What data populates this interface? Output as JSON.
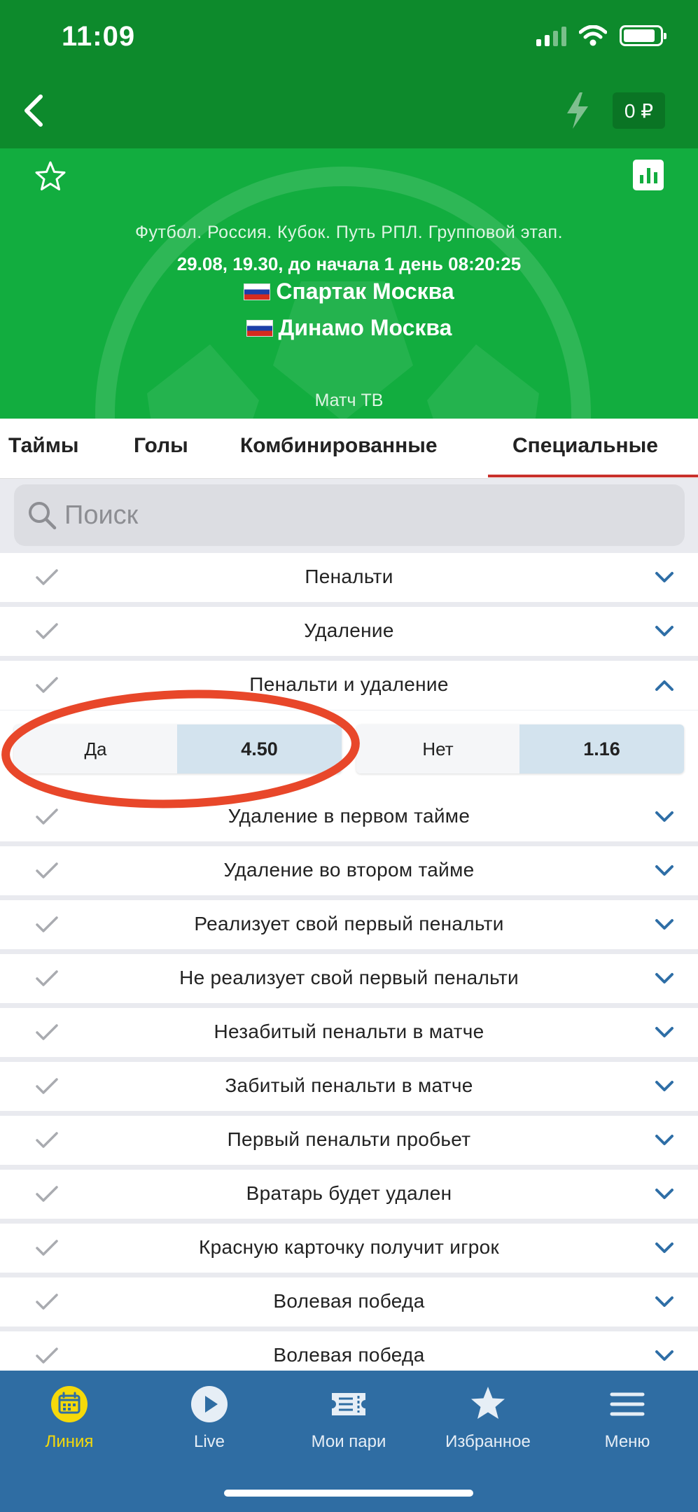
{
  "status": {
    "time": "11:09"
  },
  "topnav": {
    "balance": "0 ₽"
  },
  "match": {
    "league": "Футбол. Россия. Кубок. Путь РПЛ. Групповой этап.",
    "datetime": "29.08, 19.30,  до начала 1 день 08:20:25",
    "team1": "Спартак Москва",
    "team2": "Динамо Москва",
    "broadcast": "Матч ТВ"
  },
  "tabs": [
    {
      "label": "Таймы"
    },
    {
      "label": "Голы"
    },
    {
      "label": "Комбинированные"
    },
    {
      "label": "Специальные",
      "active": true
    }
  ],
  "search": {
    "placeholder": "Поиск"
  },
  "markets": [
    {
      "label": "Пенальти",
      "expanded": false
    },
    {
      "label": "Удаление",
      "expanded": false
    },
    {
      "label": "Пенальти и удаление",
      "expanded": true
    },
    {
      "label": "Удаление в первом тайме",
      "expanded": false
    },
    {
      "label": "Удаление во втором тайме",
      "expanded": false
    },
    {
      "label": "Реализует свой первый пенальти",
      "expanded": false
    },
    {
      "label": "Не реализует свой первый пенальти",
      "expanded": false
    },
    {
      "label": "Незабитый пенальти в матче",
      "expanded": false
    },
    {
      "label": "Забитый пенальти в матче",
      "expanded": false
    },
    {
      "label": "Первый пенальти пробьет",
      "expanded": false
    },
    {
      "label": "Вратарь будет удален",
      "expanded": false
    },
    {
      "label": "Красную карточку получит игрок",
      "expanded": false
    },
    {
      "label": "Волевая победа",
      "expanded": false
    },
    {
      "label": "Волевая победа",
      "expanded": false
    }
  ],
  "odds": {
    "yes": {
      "label": "Да",
      "value": "4.50"
    },
    "no": {
      "label": "Нет",
      "value": "1.16"
    }
  },
  "bottom_nav": [
    {
      "label": "Линия",
      "icon": "calendar-icon",
      "active": true
    },
    {
      "label": "Live",
      "icon": "play-icon"
    },
    {
      "label": "Мои пари",
      "icon": "ticket-icon"
    },
    {
      "label": "Избранное",
      "icon": "star-icon"
    },
    {
      "label": "Меню",
      "icon": "menu-icon"
    }
  ],
  "colors": {
    "topbar": "#0d8a2c",
    "match_header": "#12ad3f",
    "tab_active_underline": "#c9302c",
    "bottom_nav": "#2f6da3",
    "nav_active": "#f5d90a",
    "chevron": "#2e6ea6",
    "annotation": "#e8472a"
  }
}
